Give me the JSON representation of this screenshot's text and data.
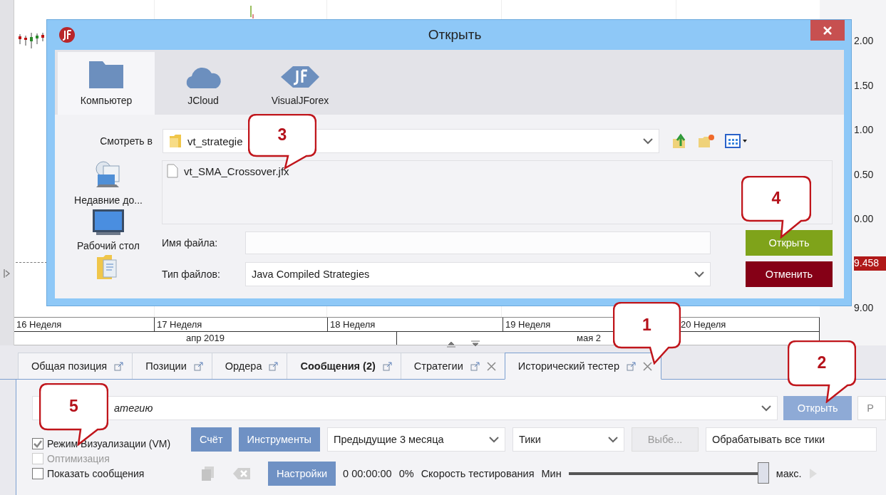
{
  "chart": {
    "price_labels": [
      {
        "text": "2.00",
        "kind": "tick"
      },
      {
        "text": "1.50",
        "kind": "tick"
      },
      {
        "text": "1.00",
        "kind": "tick"
      },
      {
        "text": "0.50",
        "kind": "tick"
      },
      {
        "text": "0.00",
        "kind": "tick"
      },
      {
        "text": "9.458",
        "kind": "current"
      },
      {
        "text": "9.00",
        "kind": "tick"
      }
    ],
    "weeks": [
      "16 Неделя",
      "17 Неделя",
      "18 Неделя",
      "19 Неделя",
      "20 Неделя"
    ],
    "months": [
      "апр 2019",
      "мая 2"
    ]
  },
  "dialog": {
    "title": "Открыть",
    "places": [
      {
        "label": "Компьютер",
        "kind": "folder",
        "selected": true
      },
      {
        "label": "JCloud",
        "kind": "cloud",
        "selected": false
      },
      {
        "label": "VisualJForex",
        "kind": "jf",
        "selected": false
      }
    ],
    "look_in_label": "Смотреть в",
    "look_in": "vt_strategie",
    "shortcuts": [
      {
        "label": "Недавние до...",
        "kind": "recent"
      },
      {
        "label": "Рабочий стол",
        "kind": "desktop"
      },
      {
        "kind": "documents"
      }
    ],
    "files": [
      "vt_SMA_Crossover.jfx"
    ],
    "file_name_label": "Имя файла:",
    "file_type_label": "Тип файлов:",
    "file_type": "Java Compiled Strategies",
    "buttons": [
      {
        "label": "Открыть",
        "kind": "primary"
      },
      {
        "label": "Отменить",
        "kind": "cancel"
      }
    ]
  },
  "tabs": [
    {
      "label": "Общая позиция",
      "selected": false,
      "bold": false,
      "closable": false
    },
    {
      "label": "Позиции",
      "selected": false,
      "bold": false,
      "closable": false
    },
    {
      "label": "Ордера",
      "selected": false,
      "bold": false,
      "closable": false
    },
    {
      "label": "Сообщения (2)",
      "selected": false,
      "bold": true,
      "closable": false
    },
    {
      "label": "Стратегии",
      "selected": false,
      "bold": false,
      "closable": true
    },
    {
      "label": "Исторический тестер",
      "selected": true,
      "bold": false,
      "closable": true
    }
  ],
  "tester": {
    "strategy": "атегию",
    "open_button": "Открыть",
    "cut_button": "Р",
    "checkboxes": [
      {
        "label": "Режим Визуализации (VM)",
        "checked": true,
        "disabled": false
      },
      {
        "label": "Оптимизация",
        "checked": false,
        "disabled": true
      },
      {
        "label": "Показать сообщения",
        "checked": false,
        "disabled": false
      }
    ],
    "account_button": "Счёт",
    "instruments_button": "Инструменты",
    "period": "Предыдущие 3 месяца",
    "data_type": "Тики",
    "select_button": "Выбе...",
    "tick_mode": "Обрабатывать все тики",
    "settings_button": "Настройки",
    "elapsed": "0 00:00:00",
    "progress": "0%",
    "speed_label": "Скорость тестирования",
    "min_label": "Мин",
    "speed": {
      "level": 1
    },
    "max_label": "макс."
  },
  "callouts": [
    "3",
    "4",
    "1",
    "2",
    "5"
  ]
}
